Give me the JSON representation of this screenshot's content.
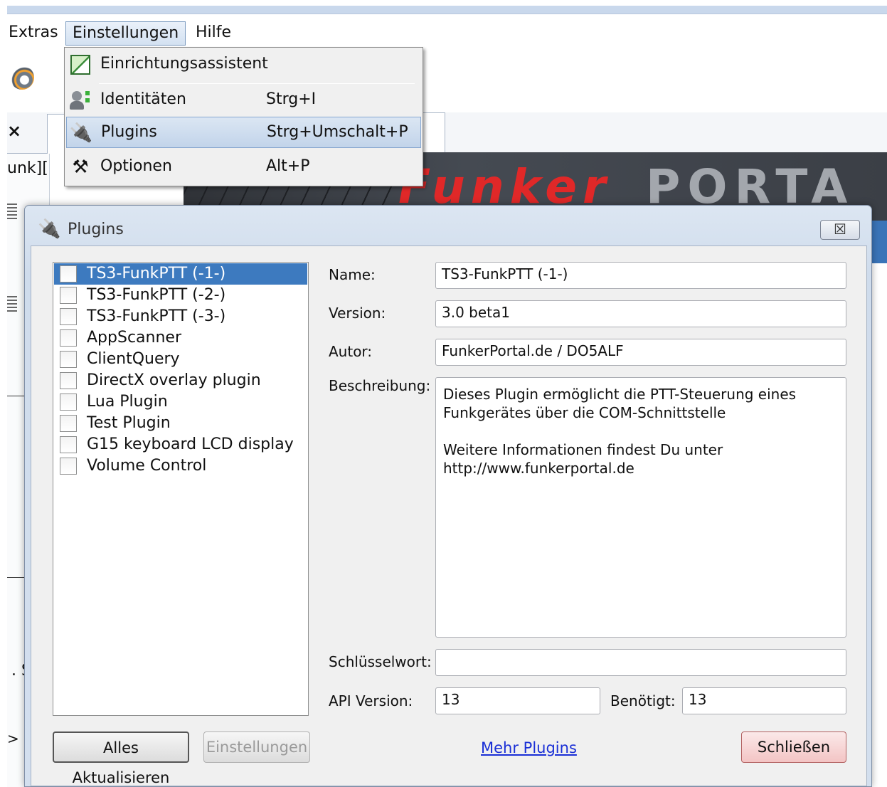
{
  "menubar": {
    "items": [
      "Extras",
      "Einstellungen",
      "Hilfe"
    ]
  },
  "background": {
    "tab_close": "×",
    "left_text": "unk][",
    "left_s": ". S",
    "left_gt": ">",
    "banner_red": "Funker",
    "banner_grey": "PORTA"
  },
  "dropdown": {
    "items": [
      {
        "label": "Einrichtungsassistent",
        "shortcut": "",
        "icon": "wizard-icon"
      },
      {
        "label": "Identitäten",
        "shortcut": "Strg+I",
        "icon": "identities-icon"
      },
      {
        "label": "Plugins",
        "shortcut": "Strg+Umschalt+P",
        "icon": "plugin-icon",
        "selected": true
      },
      {
        "label": "Optionen",
        "shortcut": "Alt+P",
        "icon": "options-tools-icon"
      }
    ]
  },
  "dialog": {
    "title": "Plugins",
    "close": "☒",
    "plugins": [
      {
        "name": "TS3-FunkPTT (-1-)",
        "checked": false,
        "selected": true
      },
      {
        "name": "TS3-FunkPTT (-2-)",
        "checked": false
      },
      {
        "name": "TS3-FunkPTT (-3-)",
        "checked": false
      },
      {
        "name": "AppScanner",
        "checked": false
      },
      {
        "name": "ClientQuery",
        "checked": false
      },
      {
        "name": "DirectX overlay plugin",
        "checked": false
      },
      {
        "name": "Lua Plugin",
        "checked": false
      },
      {
        "name": "Test Plugin",
        "checked": false
      },
      {
        "name": "G15 keyboard LCD display",
        "checked": false
      },
      {
        "name": "Volume Control",
        "checked": false
      }
    ],
    "labels": {
      "name": "Name:",
      "version": "Version:",
      "author": "Autor:",
      "description": "Beschreibung:",
      "keyword": "Schlüsselwort:",
      "api_version": "API Version:",
      "required": "Benötigt:"
    },
    "values": {
      "name": "TS3-FunkPTT (-1-)",
      "version": "3.0 beta1",
      "author": "FunkerPortal.de / DO5ALF",
      "description_p1": "Dieses Plugin ermöglicht die PTT-Steuerung eines Funkgerätes über die COM-Schnittstelle",
      "description_p2": "Weitere Informationen findest Du unter http://www.funkerportal.de",
      "keyword": "",
      "api_version": "13",
      "required": "13"
    },
    "buttons": {
      "update_all": "Alles Aktualisieren",
      "settings": "Einstellungen",
      "more_plugins": "Mehr Plugins",
      "close": "Schließen"
    }
  }
}
